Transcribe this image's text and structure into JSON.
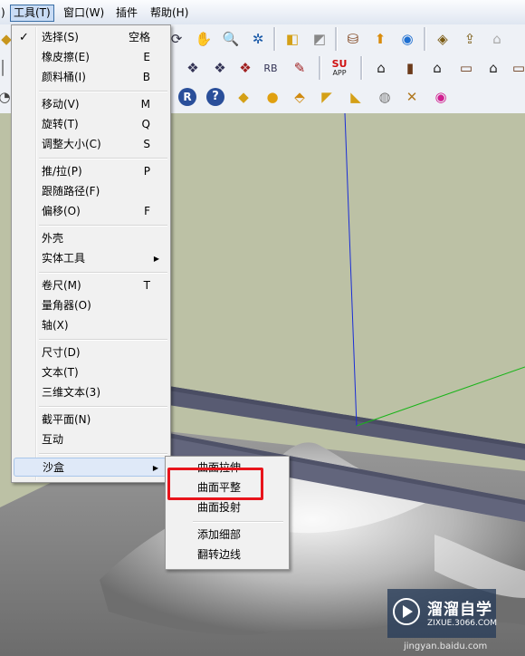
{
  "menubar": {
    "items": [
      {
        "id": "prev",
        "label": ")"
      },
      {
        "id": "tools",
        "label": "工具(T)"
      },
      {
        "id": "window",
        "label": "窗口(W)"
      },
      {
        "id": "plugins",
        "label": "插件"
      },
      {
        "id": "help",
        "label": "帮助(H)"
      }
    ]
  },
  "tools_menu": {
    "items": [
      {
        "label": "选择(S)",
        "shortcut": "空格",
        "checked": "✓"
      },
      {
        "label": "橡皮擦(E)",
        "shortcut": "E"
      },
      {
        "label": "颜料桶(I)",
        "shortcut": "B"
      },
      {
        "label": "移动(V)",
        "shortcut": "M"
      },
      {
        "label": "旋转(T)",
        "shortcut": "Q"
      },
      {
        "label": "调整大小(C)",
        "shortcut": "S"
      },
      {
        "label": "推/拉(P)",
        "shortcut": "P"
      },
      {
        "label": "跟随路径(F)",
        "shortcut": ""
      },
      {
        "label": "偏移(O)",
        "shortcut": "F"
      },
      {
        "label": "外壳",
        "shortcut": ""
      },
      {
        "label": "实体工具",
        "shortcut": "",
        "arrow": "▶"
      },
      {
        "label": "卷尺(M)",
        "shortcut": "T"
      },
      {
        "label": "量角器(O)",
        "shortcut": ""
      },
      {
        "label": "轴(X)",
        "shortcut": ""
      },
      {
        "label": "尺寸(D)",
        "shortcut": ""
      },
      {
        "label": "文本(T)",
        "shortcut": ""
      },
      {
        "label": "三维文本(3)",
        "shortcut": ""
      },
      {
        "label": "截平面(N)",
        "shortcut": ""
      },
      {
        "label": "互动",
        "shortcut": ""
      },
      {
        "label": "沙盒",
        "shortcut": "",
        "arrow": "▶"
      }
    ]
  },
  "sandbox_submenu": {
    "items": [
      {
        "label": "曲面拉伸"
      },
      {
        "label": "曲面平整"
      },
      {
        "label": "曲面投射"
      },
      {
        "label": "添加细部"
      },
      {
        "label": "翻转边线"
      }
    ]
  },
  "toolbar": {
    "su_app_top": "SU",
    "su_app_bottom": "APP",
    "rb_label": "RB",
    "r_label": "R",
    "q_label": "?"
  },
  "watermark": {
    "title": "溜溜自学",
    "url": "ZIXUE.3066.COM",
    "footer": "jingyan.baidu.com"
  },
  "colors": {
    "highlight_box": "#e8141b",
    "menu_bg": "#f1f1f1",
    "blue_axis": "#1a2dd6",
    "green_axis": "#19b419"
  }
}
